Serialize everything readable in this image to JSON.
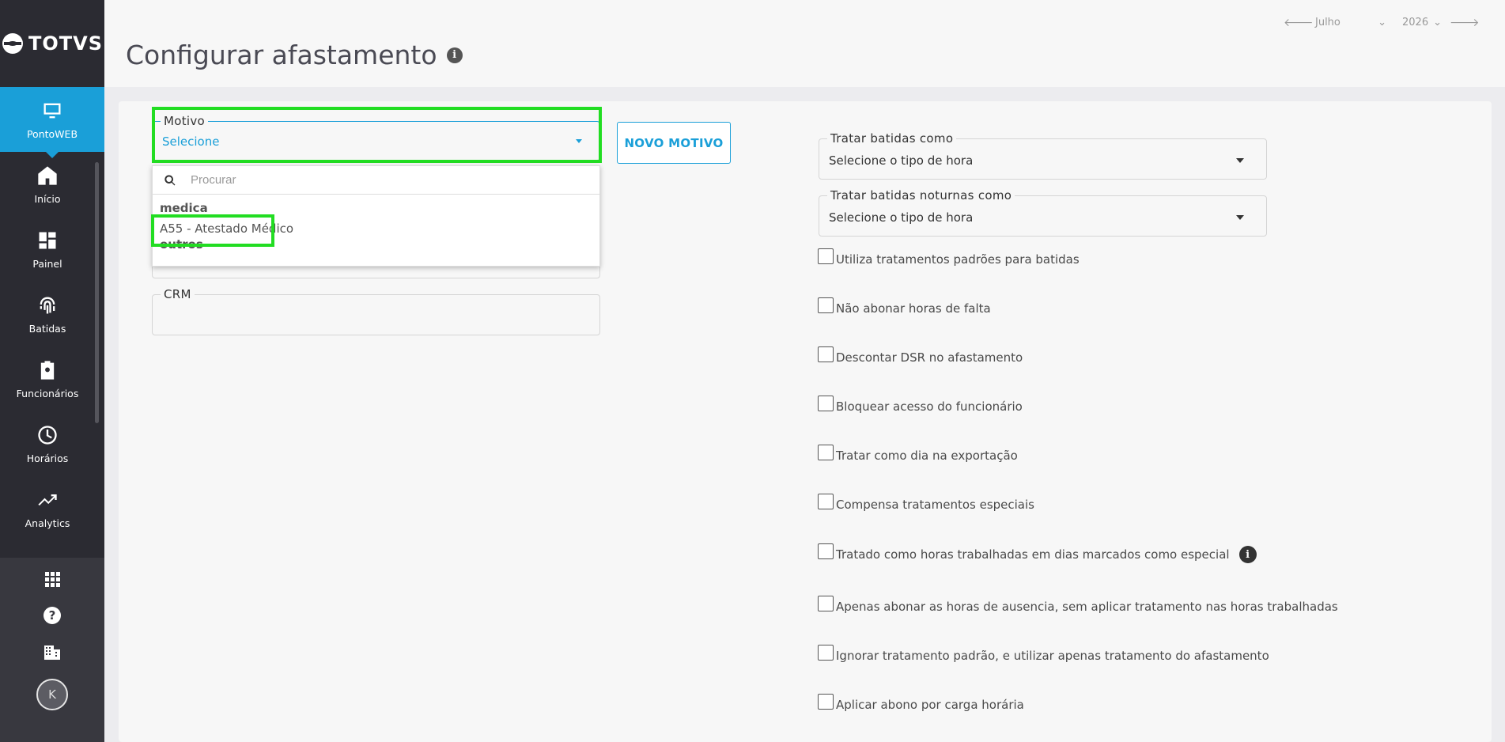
{
  "app": {
    "logo_text": "TOTVS"
  },
  "sidebar": {
    "items": [
      {
        "label": "PontoWEB",
        "icon": "monitor-icon",
        "active": true
      },
      {
        "label": "Início",
        "icon": "home-icon"
      },
      {
        "label": "Painel",
        "icon": "dashboard-icon"
      },
      {
        "label": "Batidas",
        "icon": "fingerprint-icon"
      },
      {
        "label": "Funcionários",
        "icon": "badge-icon"
      },
      {
        "label": "Horários",
        "icon": "clock-icon"
      },
      {
        "label": "Analytics",
        "icon": "trending-up-icon"
      }
    ],
    "bottom": {
      "apps_icon": "apps-grid-icon",
      "help_icon": "help-icon",
      "company_icon": "building-icon",
      "avatar_initial": "K"
    }
  },
  "header": {
    "title": "Configurar afastamento",
    "month": "Julho",
    "year": "2026"
  },
  "form": {
    "motivo": {
      "label": "Motivo",
      "value": "Selecione",
      "new_button": "NOVO MOTIVO",
      "dropdown": {
        "search_placeholder": "Procurar",
        "groups": [
          {
            "label": "medica",
            "options": [
              "A55 - Atestado Médico"
            ]
          },
          {
            "label": "outros",
            "options": []
          }
        ]
      }
    },
    "crm": {
      "label": "CRM",
      "value": ""
    },
    "tratar_batidas": {
      "label": "Tratar batidas como",
      "value": "Selecione o tipo de hora"
    },
    "tratar_noturnas": {
      "label": "Tratar batidas noturnas como",
      "value": "Selecione o tipo de hora"
    },
    "checkboxes": [
      "Utiliza tratamentos padrões para batidas",
      "Não abonar horas de falta",
      "Descontar DSR no afastamento",
      "Bloquear acesso do funcionário",
      "Tratar como dia na exportação",
      "Compensa tratamentos especiais",
      "Tratado como horas trabalhadas em dias marcados como especial",
      "Apenas abonar as horas de ausencia, sem aplicar tratamento nas horas trabalhadas",
      "Ignorar tratamento padrão, e utilizar apenas tratamento do afastamento",
      "Aplicar abono por carga horária"
    ]
  },
  "colors": {
    "accent": "#1a9fd8",
    "sidebar": "#2b2b32",
    "highlight": "#22dd22"
  }
}
